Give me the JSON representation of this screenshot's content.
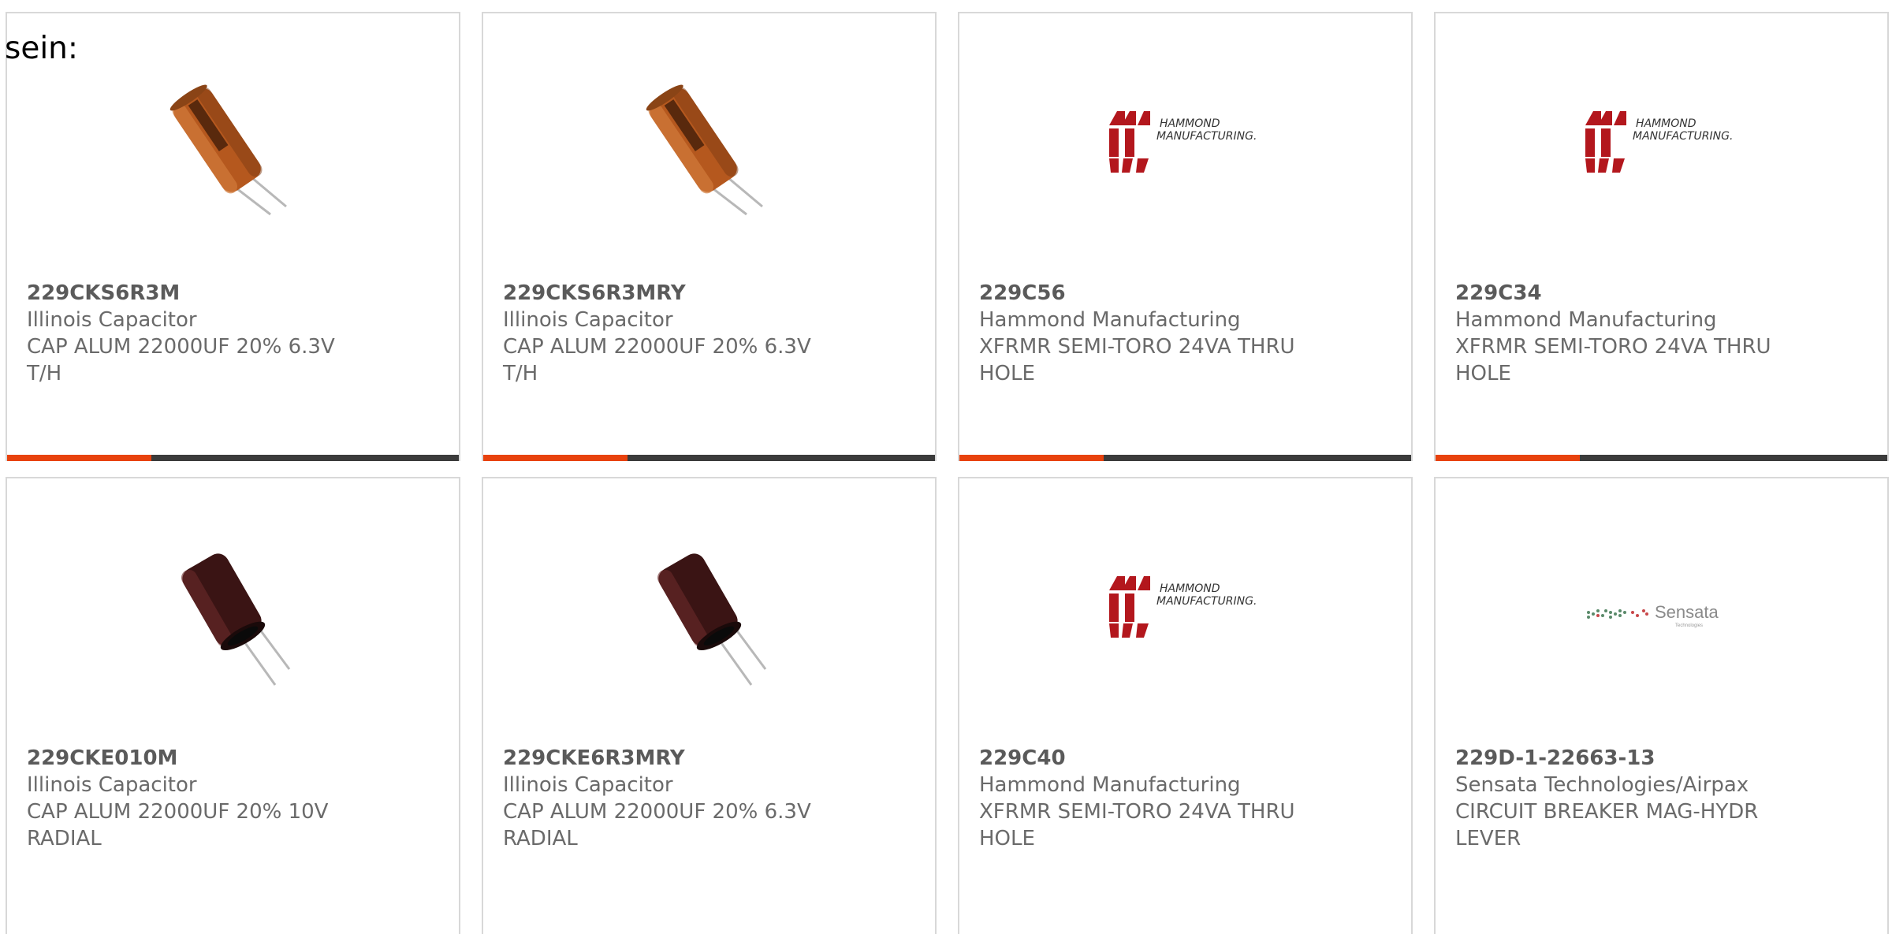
{
  "heading": "sein:",
  "colors": {
    "accent": "#e8420d",
    "bar_track": "#3b3b3b",
    "hammond_red": "#b3171d",
    "capacitor_orange": "#b5581e",
    "capacitor_brown": "#3a1414"
  },
  "products": [
    {
      "part_number": "229CKS6R3M",
      "manufacturer": "Illinois Capacitor",
      "desc_line1": "CAP ALUM 22000UF 20% 6.3V",
      "desc_line2": "T/H",
      "image": "orange-capacitor-image",
      "progress": 0.32
    },
    {
      "part_number": "229CKS6R3MRY",
      "manufacturer": "Illinois Capacitor",
      "desc_line1": "CAP ALUM 22000UF 20% 6.3V",
      "desc_line2": "T/H",
      "image": "orange-capacitor-image",
      "progress": 0.32
    },
    {
      "part_number": "229C56",
      "manufacturer": "Hammond Manufacturing",
      "desc_line1": "XFRMR SEMI-TORO 24VA THRU",
      "desc_line2": "HOLE",
      "image": "hammond-logo",
      "logo_line1": "HAMMOND",
      "logo_line2": "MANUFACTURING.",
      "progress": 0.32
    },
    {
      "part_number": "229C34",
      "manufacturer": "Hammond Manufacturing",
      "desc_line1": "XFRMR SEMI-TORO 24VA THRU",
      "desc_line2": "HOLE",
      "image": "hammond-logo",
      "logo_line1": "HAMMOND",
      "logo_line2": "MANUFACTURING.",
      "progress": 0.32
    },
    {
      "part_number": "229CKE010M",
      "manufacturer": "Illinois Capacitor",
      "desc_line1": "CAP ALUM 22000UF 20% 10V",
      "desc_line2": "RADIAL",
      "image": "brown-capacitor-image"
    },
    {
      "part_number": "229CKE6R3MRY",
      "manufacturer": "Illinois Capacitor",
      "desc_line1": "CAP ALUM 22000UF 20% 6.3V",
      "desc_line2": "RADIAL",
      "image": "brown-capacitor-image"
    },
    {
      "part_number": "229C40",
      "manufacturer": "Hammond Manufacturing",
      "desc_line1": "XFRMR SEMI-TORO 24VA THRU",
      "desc_line2": "HOLE",
      "image": "hammond-logo",
      "logo_line1": "HAMMOND",
      "logo_line2": "MANUFACTURING."
    },
    {
      "part_number": "229D-1-22663-13",
      "manufacturer": "Sensata Technologies/Airpax",
      "desc_line1": "CIRCUIT BREAKER MAG-HYDR",
      "desc_line2": "LEVER",
      "image": "sensata-logo",
      "logo_text": "Sensata",
      "logo_sub": "Technologies"
    }
  ]
}
